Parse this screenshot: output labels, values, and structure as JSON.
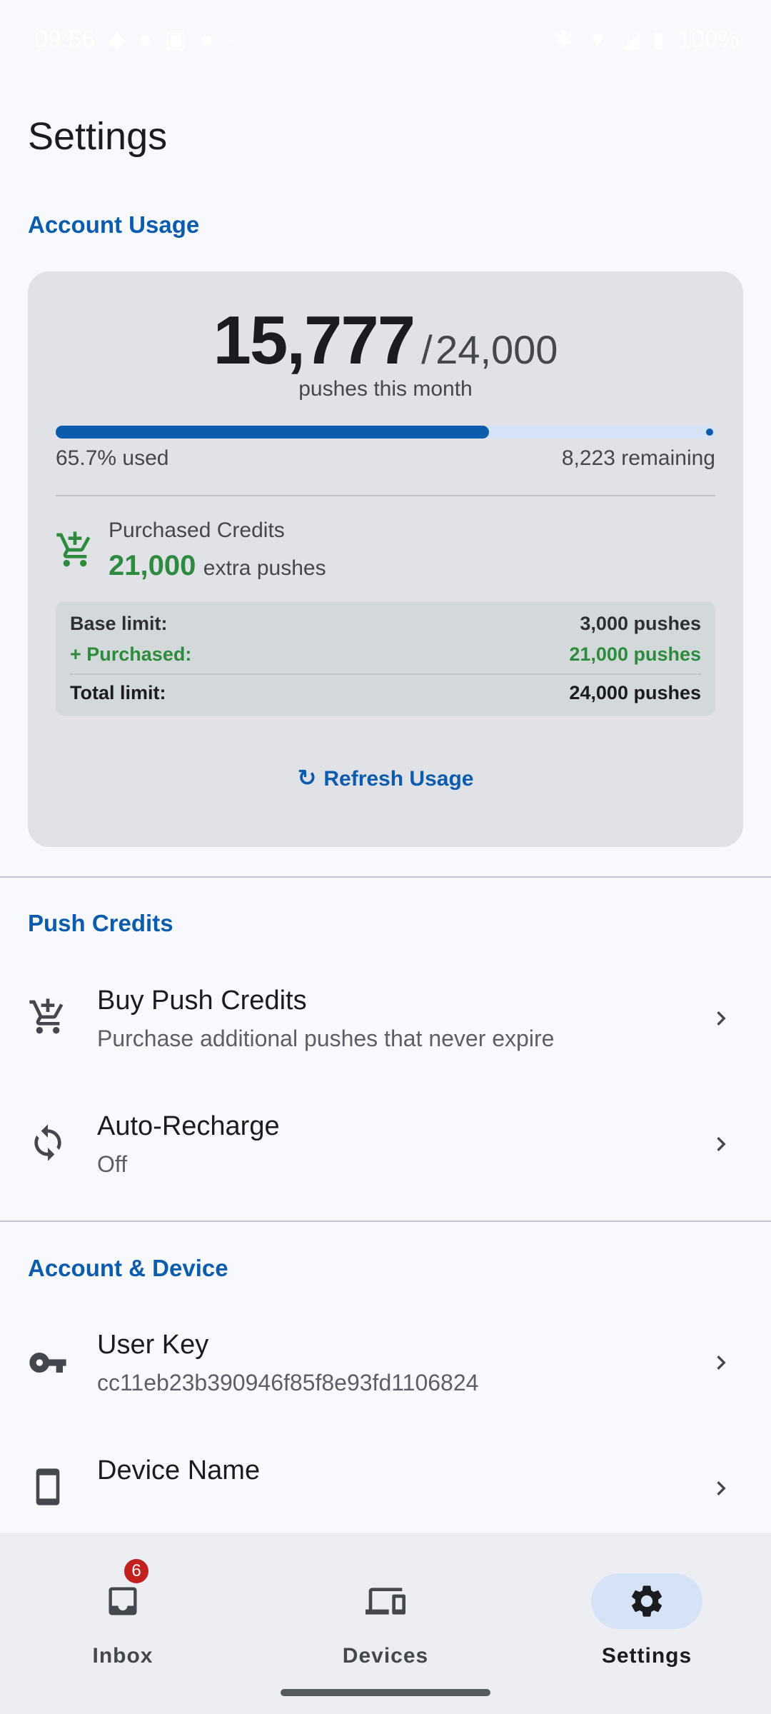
{
  "status_bar": {
    "time": "09:56",
    "battery": "100%"
  },
  "page": {
    "title": "Settings"
  },
  "account_usage": {
    "header": "Account Usage",
    "used": "15,777",
    "separator": "/",
    "limit": "24,000",
    "caption": "pushes this month",
    "progress_fraction": 0.657,
    "percent_used": "65.7% used",
    "remaining": "8,223 remaining",
    "purchased_title": "Purchased Credits",
    "purchased_amount": "21,000",
    "purchased_unit": "extra pushes",
    "breakdown": {
      "base_label": "Base limit:",
      "base_value": "3,000 pushes",
      "purchased_label": "+ Purchased:",
      "purchased_value": "21,000 pushes",
      "total_label": "Total limit:",
      "total_value": "24,000 pushes"
    },
    "refresh_label": "Refresh Usage",
    "colors": {
      "accent": "#0b5cad",
      "purchased_green": "#2e8b3d",
      "card_bg": "#e1e2e8"
    }
  },
  "push_credits": {
    "header": "Push Credits",
    "items": [
      {
        "title": "Buy Push Credits",
        "subtitle": "Purchase additional pushes that never expire",
        "icon": "cart-add-icon"
      },
      {
        "title": "Auto-Recharge",
        "subtitle": "Off",
        "icon": "sync-icon"
      }
    ]
  },
  "account_device": {
    "header": "Account & Device",
    "items": [
      {
        "title": "User Key",
        "subtitle": "cc11eb23b390946f85f8e93fd1106824",
        "icon": "key-icon"
      },
      {
        "title": "Device Name",
        "subtitle": "",
        "icon": "phone-icon"
      }
    ]
  },
  "bottom_nav": {
    "items": [
      {
        "label": "Inbox",
        "badge": "6",
        "icon": "inbox-icon",
        "active": false
      },
      {
        "label": "Devices",
        "icon": "devices-icon",
        "active": false
      },
      {
        "label": "Settings",
        "icon": "gear-icon",
        "active": true
      }
    ]
  }
}
